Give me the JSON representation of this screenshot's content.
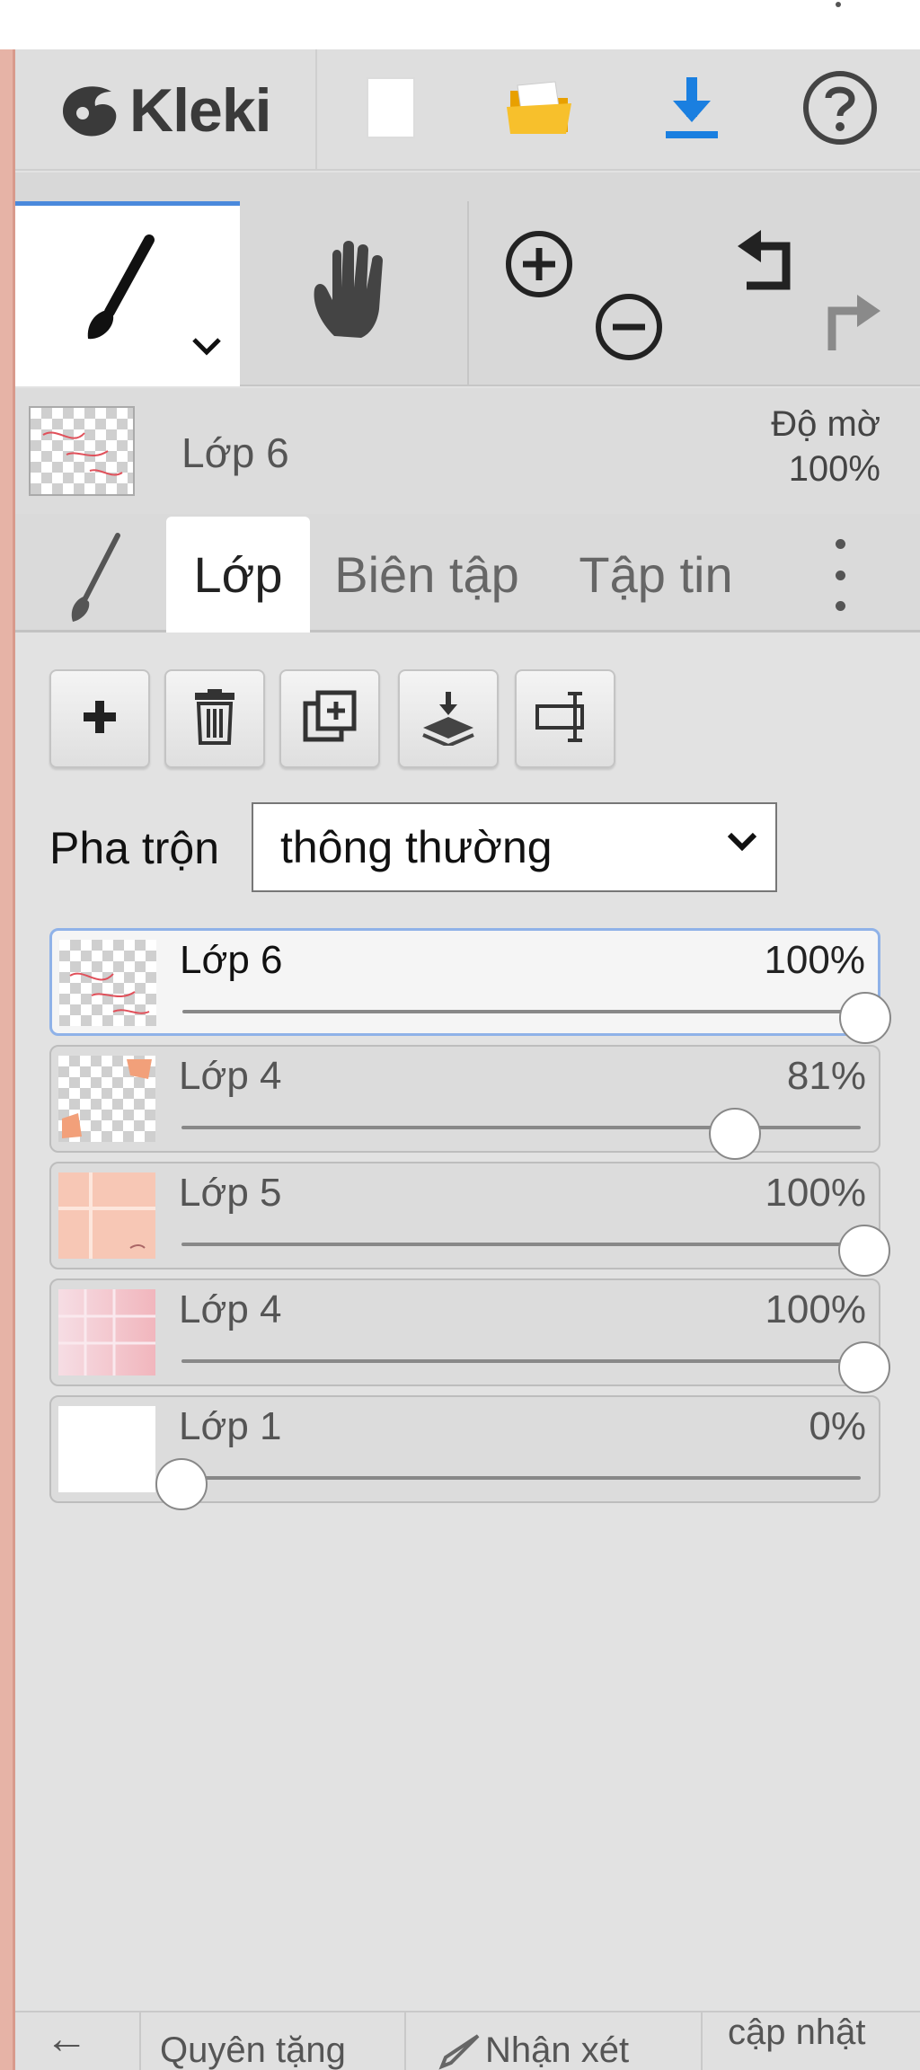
{
  "app": {
    "name": "Kleki"
  },
  "header": {
    "new_icon": "new-document-icon",
    "open_icon": "folder-icon",
    "save_icon": "download-icon",
    "help_icon": "help-icon",
    "accent_color": "#1a7fe0"
  },
  "tools": {
    "active": "brush",
    "items": [
      "brush",
      "hand",
      "zoom",
      "undo-redo"
    ]
  },
  "current_layer": {
    "name": "Lớp 6",
    "opacity_label": "Độ mờ",
    "opacity_value": "100%"
  },
  "tabs": [
    {
      "label": "Lớp",
      "active": true
    },
    {
      "label": "Biên tập",
      "active": false
    },
    {
      "label": "Tập tin",
      "active": false
    }
  ],
  "layer_actions": [
    "add-layer-icon",
    "delete-layer-icon",
    "duplicate-layer-icon",
    "merge-down-icon",
    "rename-layer-icon"
  ],
  "blend": {
    "label": "Pha trộn",
    "value": "thông thường"
  },
  "layers": [
    {
      "name": "Lớp 6",
      "opacity_text": "100%",
      "opacity": 1.0,
      "selected": true,
      "thumb": "checker-red"
    },
    {
      "name": "Lớp 4",
      "opacity_text": "81%",
      "opacity": 0.81,
      "selected": false,
      "thumb": "checker-orange"
    },
    {
      "name": "Lớp 5",
      "opacity_text": "100%",
      "opacity": 1.0,
      "selected": false,
      "thumb": "peach"
    },
    {
      "name": "Lớp 4",
      "opacity_text": "100%",
      "opacity": 1.0,
      "selected": false,
      "thumb": "pink-gradient"
    },
    {
      "name": "Lớp 1",
      "opacity_text": "0%",
      "opacity": 0.0,
      "selected": false,
      "thumb": "white"
    }
  ],
  "bottom_bar": {
    "back_arrow": "←",
    "donate": "Quyên tặng",
    "feedback": "Nhận xét",
    "update": "cập nhật"
  }
}
